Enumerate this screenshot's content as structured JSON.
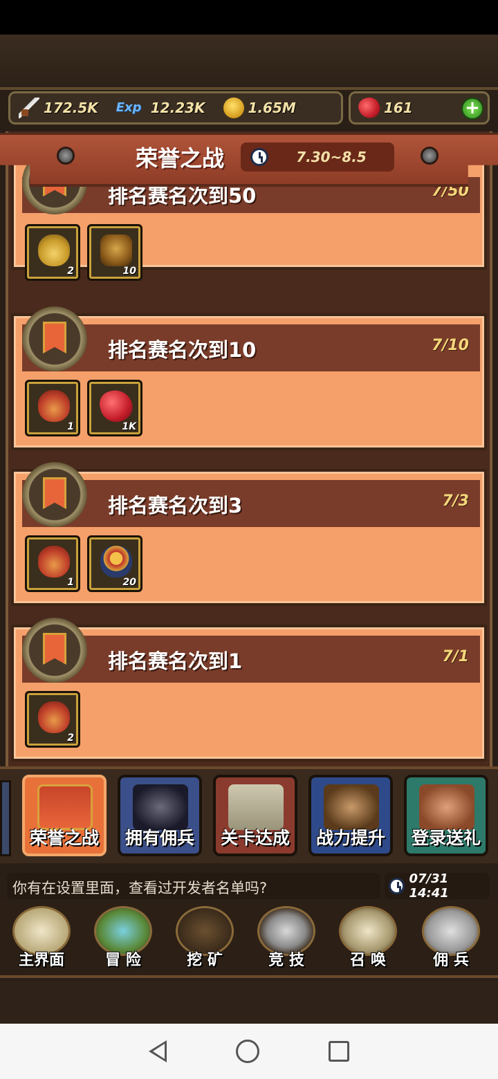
{
  "resources": {
    "power": "172.5K",
    "exp_label": "Exp",
    "exp": "12.23K",
    "gold": "1.65M",
    "gems": "161",
    "add_label": "+"
  },
  "event": {
    "title": "荣誉之战",
    "period": "7.30~8.5"
  },
  "tasks": [
    {
      "title": "排名赛名次到50",
      "progress": "7/50",
      "rewards": [
        {
          "icon": "gift-bag-gold-icon",
          "qty": "2"
        },
        {
          "icon": "golden-armor-icon",
          "qty": "10"
        }
      ]
    },
    {
      "title": "排名赛名次到10",
      "progress": "7/10",
      "rewards": [
        {
          "icon": "gift-bag-icon",
          "qty": "1"
        },
        {
          "icon": "ruby-gem-icon",
          "qty": "1K"
        }
      ]
    },
    {
      "title": "排名赛名次到3",
      "progress": "7/3",
      "rewards": [
        {
          "icon": "gift-bag-icon",
          "qty": "1"
        },
        {
          "icon": "medal-badge-icon",
          "qty": "20"
        }
      ]
    },
    {
      "title": "排名赛名次到1",
      "progress": "7/1",
      "rewards": [
        {
          "icon": "gift-bag-icon",
          "qty": "2"
        }
      ]
    }
  ],
  "tabs": [
    {
      "label": "荣誉之战",
      "color": "#e8713a"
    },
    {
      "label": "拥有佣兵",
      "color": "#3b4f8a"
    },
    {
      "label": "关卡达成",
      "color": "#8a3b2e"
    },
    {
      "label": "战力提升",
      "color": "#2e4a8a"
    },
    {
      "label": "登录送礼",
      "color": "#2e7a6a"
    }
  ],
  "ticker": {
    "message": "你有在设置里面，查看过开发者名单吗?",
    "time": "07/31 14:41"
  },
  "nav": [
    {
      "label": "主界面",
      "icon": "map-scroll-icon"
    },
    {
      "label": "冒 险",
      "icon": "island-icon"
    },
    {
      "label": "挖 矿",
      "icon": "pickaxe-icon"
    },
    {
      "label": "竞 技",
      "icon": "crossed-swords-icon"
    },
    {
      "label": "召 唤",
      "icon": "summon-scroll-icon"
    },
    {
      "label": "佣 兵",
      "icon": "tent-icon"
    }
  ]
}
